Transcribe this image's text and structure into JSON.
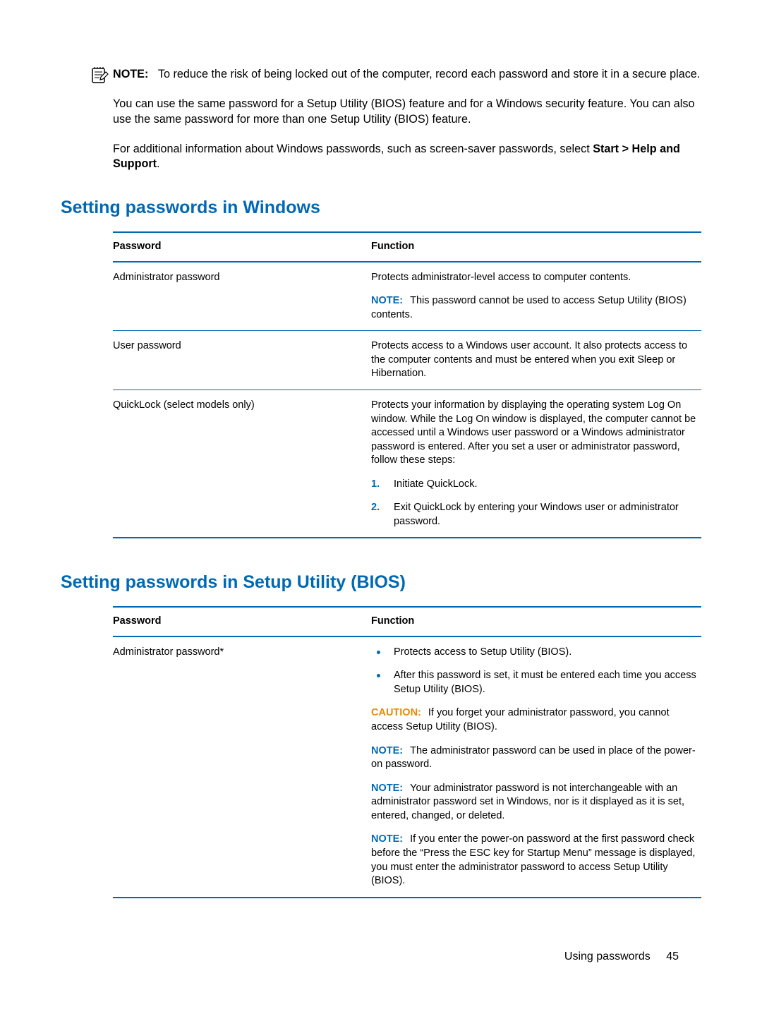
{
  "intro": {
    "note_label": "NOTE:",
    "note_text": "To reduce the risk of being locked out of the computer, record each password and store it in a secure place.",
    "para1": "You can use the same password for a Setup Utility (BIOS) feature and for a Windows security feature. You can also use the same password for more than one Setup Utility (BIOS) feature.",
    "para2_pre": "For additional information about Windows passwords, such as screen-saver passwords, select ",
    "para2_bold": "Start > Help and Support",
    "para2_post": "."
  },
  "section1": {
    "heading": "Setting passwords in Windows",
    "col_pw": "Password",
    "col_fn": "Function",
    "rows": [
      {
        "pw": "Administrator password",
        "fn_main": "Protects administrator-level access to computer contents.",
        "note_label": "NOTE:",
        "note_text": "This password cannot be used to access Setup Utility (BIOS) contents."
      },
      {
        "pw": "User password",
        "fn_main": "Protects access to a Windows user account. It also protects access to the computer contents and must be entered when you exit Sleep or Hibernation."
      },
      {
        "pw": "QuickLock (select models only)",
        "fn_main": "Protects your information by displaying the operating system Log On window. While the Log On window is displayed, the computer cannot be accessed until a Windows user password or a Windows administrator password is entered. After you set a user or administrator password, follow these steps:",
        "step1": "Initiate QuickLock.",
        "step2": "Exit QuickLock by entering your Windows user or administrator password."
      }
    ]
  },
  "section2": {
    "heading": "Setting passwords in Setup Utility (BIOS)",
    "col_pw": "Password",
    "col_fn": "Function",
    "row": {
      "pw": "Administrator password*",
      "bullet1": "Protects access to Setup Utility (BIOS).",
      "bullet2": "After this password is set, it must be entered each time you access Setup Utility (BIOS).",
      "caution_label": "CAUTION:",
      "caution_text": "If you forget your administrator password, you cannot access Setup Utility (BIOS).",
      "note1_label": "NOTE:",
      "note1_text": "The administrator password can be used in place of the power-on password.",
      "note2_label": "NOTE:",
      "note2_text": "Your administrator password is not interchangeable with an administrator password set in Windows, nor is it displayed as it is set, entered, changed, or deleted.",
      "note3_label": "NOTE:",
      "note3_text": "If you enter the power-on password at the first password check before the “Press the ESC key for Startup Menu” message is displayed, you must enter the administrator password to access Setup Utility (BIOS)."
    }
  },
  "footer": {
    "title": "Using passwords",
    "page": "45"
  }
}
